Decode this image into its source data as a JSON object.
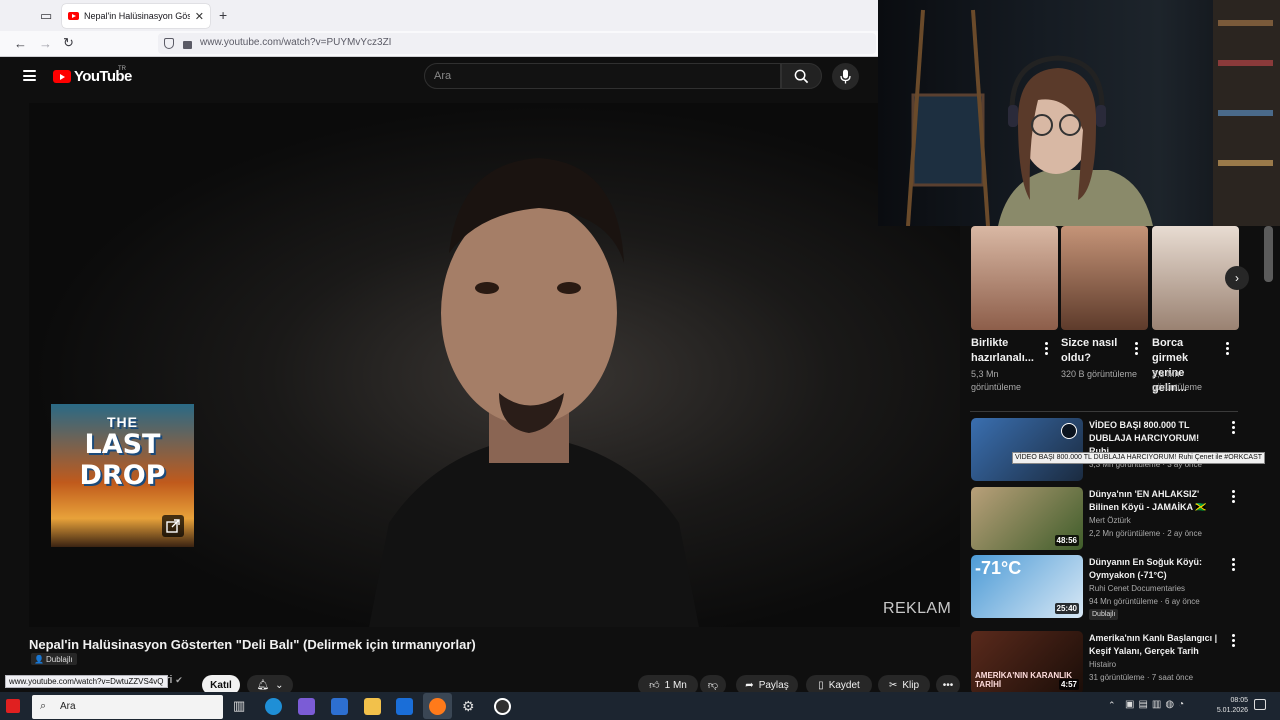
{
  "browser": {
    "tab_title": "Nepal'in Halüsinasyon Gösterten",
    "tab_close": "✕",
    "new_tab": "+",
    "url": "www.youtube.com/watch?v=PUYMvYcz3ZI",
    "status_url": "www.youtube.com/watch?v=DwtuZZVS4vQ"
  },
  "youtube": {
    "logo_text": "YouTube",
    "country_code": "TR",
    "search_placeholder": "Ara"
  },
  "video": {
    "ad_card_line1": "THE",
    "ad_card_line2": "LAST DROP",
    "ad_label": "REKLAM",
    "title": "Nepal'in Halüsinasyon Gösterten \"Deli Balı\" (Delirmek için tırmanıyorlar)",
    "dub_label": "Dublajlı",
    "channel_fragment": "eri",
    "join_label": "Katıl",
    "likes": "1 Mn",
    "share_label": "Paylaş",
    "save_label": "Kaydet",
    "clip_label": "Klip"
  },
  "shorts": [
    {
      "title": "Birlikte hazırlanalı...",
      "views": "5,3 Mn görüntüleme",
      "colors": [
        "#d9b8a4",
        "#8d5e4a"
      ]
    },
    {
      "title": "Sizce nasıl oldu?",
      "views": "320 B görüntüleme",
      "colors": [
        "#c59478",
        "#5e3b2b"
      ]
    },
    {
      "title": "Borca girmek yerine gelin...",
      "views": "2,3 Mn görüntüleme",
      "colors": [
        "#e8dcd2",
        "#9a8272"
      ]
    }
  ],
  "recommended": [
    {
      "title": "VİDEO BAŞI 800.000 TL DUBLAJA HARCIYORUM! Ruhi...",
      "channel": "",
      "meta": "3,3 Mn görüntüleme · 3 ay önce",
      "duration": "",
      "dubbed": false,
      "colors": [
        "#3a6fb0",
        "#1b2b40"
      ]
    },
    {
      "title": "Dünya'nın 'EN AHLAKSIZ' Bilinen Köyü - JAMAİKA 🇯🇲",
      "channel": "Mert Öztürk",
      "meta": "2,2 Mn görüntüleme · 2 ay önce",
      "duration": "48:56",
      "dubbed": false,
      "colors": [
        "#b9a07a",
        "#3f5d2a"
      ]
    },
    {
      "title": "Dünyanın En Soğuk Köyü: Oymyakon (-71°C)",
      "channel": "Ruhi Cenet Documentaries",
      "meta": "94 Mn görüntüleme · 6 ay önce",
      "duration": "25:40",
      "dubbed": true,
      "thumb_text": "-71°C",
      "colors": [
        "#4d9bd6",
        "#d8e8f5"
      ]
    },
    {
      "title": "Amerika'nın Kanlı Başlangıcı | Keşif Yalanı, Gerçek Tarih",
      "channel": "Histairo",
      "meta": "31 görüntüleme · 7 saat önce",
      "duration": "4:57",
      "dubbed": false,
      "thumb_text": "AMERİKA'NIN KARANLIK TARİHİ",
      "colors": [
        "#5a2a1c",
        "#1a0d08"
      ]
    }
  ],
  "recommended_dub_label": "Dublajlı",
  "tooltip": "VİDEO BAŞI 800.000 TL DUBLAJA HARCIYORUM! Ruhi Çenet ile #ORKCAST",
  "taskbar": {
    "search_text": "Ara",
    "time": "08:05",
    "date": "5.01.2026"
  }
}
